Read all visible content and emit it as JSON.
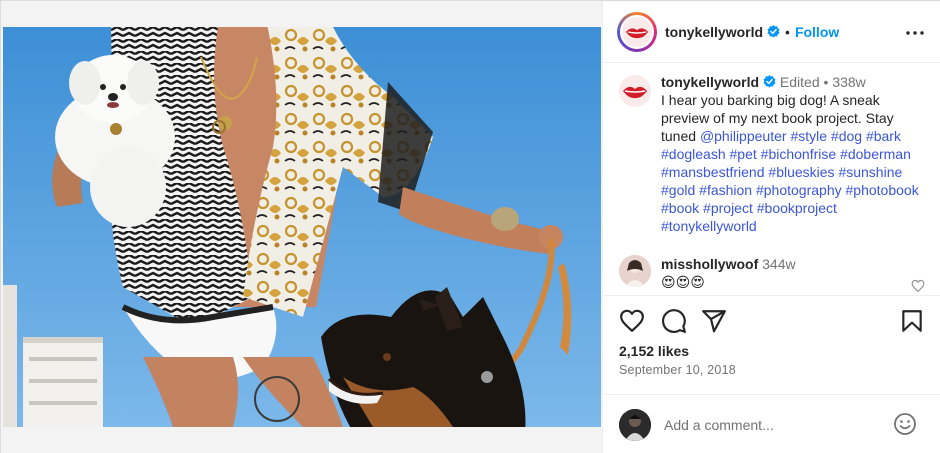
{
  "post": {
    "username": "tonykellyworld",
    "separator": "•",
    "follow_label": "Follow",
    "caption": {
      "username": "tonykellyworld",
      "edited_label": "Edited",
      "edited_sep": "•",
      "age": "338w",
      "text": "I hear you barking big dog! A sneak preview of my next book project. Stay tuned",
      "mention": "@philippeuter",
      "hashtags": [
        "#style",
        "#dog",
        "#bark",
        "#dogleash",
        "#pet",
        "#bichonfrise",
        "#doberman",
        "#mansbestfriend",
        "#blueskies",
        "#sunshine",
        "#gold",
        "#fashion",
        "#photography",
        "#photobook",
        "#book",
        "#project",
        "#bookproject",
        "#tonykellyworld"
      ]
    },
    "comments": [
      {
        "username": "misshollywoof",
        "age": "344w",
        "text": "😍😍😍"
      }
    ],
    "likes": "2,152 likes",
    "date": "September 10, 2018",
    "add_comment_placeholder": "Add a comment..."
  },
  "icons": {
    "verified": "verified-badge-icon",
    "more": "more-options-icon",
    "like": "heart-icon",
    "comment": "comment-bubble-icon",
    "share": "paper-plane-icon",
    "save": "bookmark-icon",
    "emoji": "smiley-face-icon"
  },
  "colors": {
    "accent": "#0095f6",
    "hashtag": "#3b56d8",
    "muted": "#737373",
    "verified": "#0095f6"
  }
}
